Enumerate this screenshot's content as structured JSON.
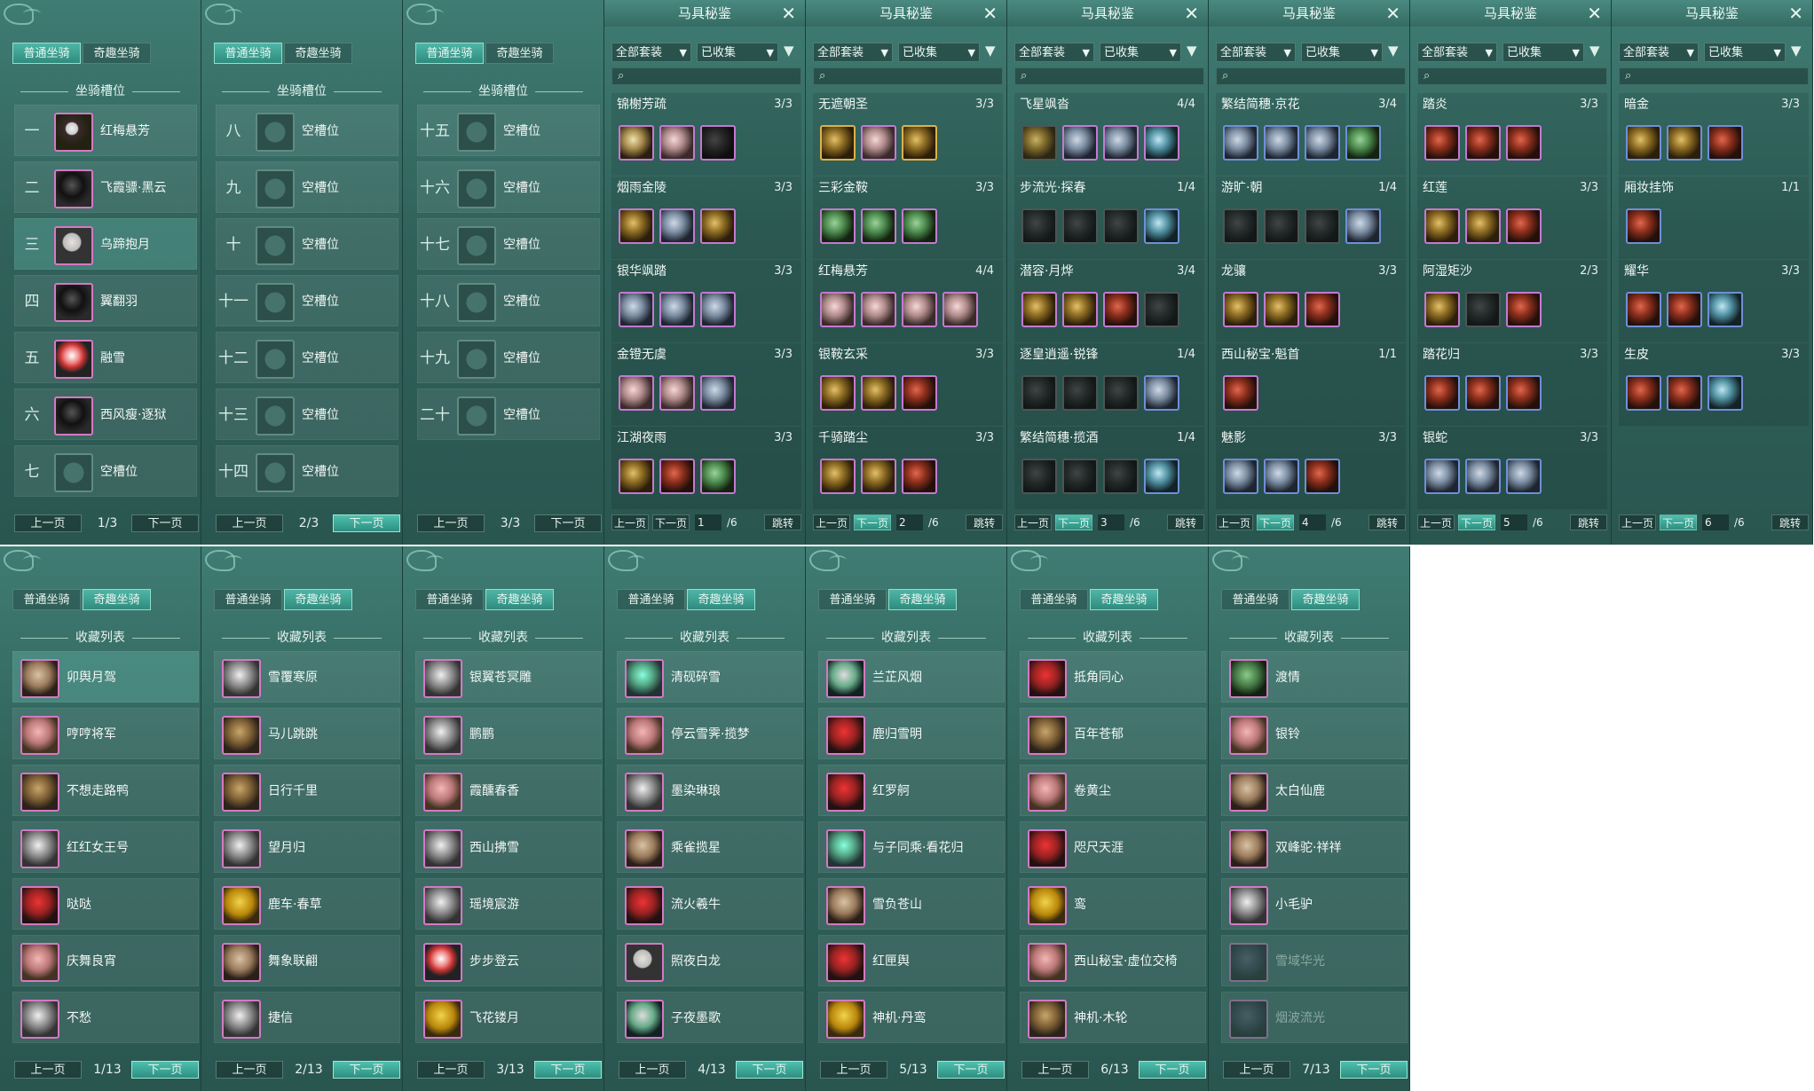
{
  "tabs": {
    "normal": "普通坐骑",
    "fun": "奇趣坐骑"
  },
  "slots_section": "坐骑槽位",
  "collection_section": "收藏列表",
  "pager": {
    "prev": "上一页",
    "next": "下一页"
  },
  "slot_pages": [
    {
      "page": "1/3",
      "slots": [
        {
          "num": "一",
          "name": "红梅悬芳"
        },
        {
          "num": "二",
          "name": "飞霞骠·黑云"
        },
        {
          "num": "三",
          "name": "乌蹄抱月"
        },
        {
          "num": "四",
          "name": "翼翻羽"
        },
        {
          "num": "五",
          "name": "融雪"
        },
        {
          "num": "六",
          "name": "西风瘦·逐狱"
        },
        {
          "num": "七",
          "name": "空槽位"
        }
      ]
    },
    {
      "page": "2/3",
      "slots": [
        {
          "num": "八",
          "name": "空槽位"
        },
        {
          "num": "九",
          "name": "空槽位"
        },
        {
          "num": "十",
          "name": "空槽位"
        },
        {
          "num": "十一",
          "name": "空槽位"
        },
        {
          "num": "十二",
          "name": "空槽位"
        },
        {
          "num": "十三",
          "name": "空槽位"
        },
        {
          "num": "十四",
          "name": "空槽位"
        }
      ]
    },
    {
      "page": "3/3",
      "slots": [
        {
          "num": "十五",
          "name": "空槽位"
        },
        {
          "num": "十六",
          "name": "空槽位"
        },
        {
          "num": "十七",
          "name": "空槽位"
        },
        {
          "num": "十八",
          "name": "空槽位"
        },
        {
          "num": "十九",
          "name": "空槽位"
        },
        {
          "num": "二十",
          "name": "空槽位"
        }
      ]
    }
  ],
  "gear": {
    "title": "马具秘鉴",
    "filter_all": "全部套装",
    "filter_collected": "已收集",
    "jump": "跳转",
    "total": "/6",
    "pages": [
      {
        "page": "1",
        "sets": [
          {
            "name": "锦榭芳疏",
            "count": "3/3"
          },
          {
            "name": "烟雨金陵",
            "count": "3/3"
          },
          {
            "name": "银华飒踏",
            "count": "3/3"
          },
          {
            "name": "金镫无虞",
            "count": "3/3"
          },
          {
            "name": "江湖夜雨",
            "count": "3/3"
          }
        ]
      },
      {
        "page": "2",
        "sets": [
          {
            "name": "无遮朝圣",
            "count": "3/3"
          },
          {
            "name": "三彩金鞍",
            "count": "3/3"
          },
          {
            "name": "红梅悬芳",
            "count": "4/4"
          },
          {
            "name": "银鞍玄采",
            "count": "3/3"
          },
          {
            "name": "千骑踏尘",
            "count": "3/3"
          }
        ]
      },
      {
        "page": "3",
        "sets": [
          {
            "name": "飞星飒沓",
            "count": "4/4"
          },
          {
            "name": "步流光·探春",
            "count": "1/4"
          },
          {
            "name": "潜容·月烨",
            "count": "3/4"
          },
          {
            "name": "逐皇逍遥·锐锋",
            "count": "1/4"
          },
          {
            "name": "繁结简穗·揽酒",
            "count": "1/4"
          }
        ]
      },
      {
        "page": "4",
        "sets": [
          {
            "name": "繁结简穗·京花",
            "count": "3/4"
          },
          {
            "name": "游旷·朝",
            "count": "1/4"
          },
          {
            "name": "龙骧",
            "count": "3/3"
          },
          {
            "name": "西山秘宝·魁首",
            "count": "1/1"
          },
          {
            "name": "魅影",
            "count": "3/3"
          }
        ]
      },
      {
        "page": "5",
        "sets": [
          {
            "name": "踏炎",
            "count": "3/3"
          },
          {
            "name": "红莲",
            "count": "3/3"
          },
          {
            "name": "阿湿矩沙",
            "count": "2/3"
          },
          {
            "name": "踏花归",
            "count": "3/3"
          },
          {
            "name": "银蛇",
            "count": "3/3"
          }
        ]
      },
      {
        "page": "6",
        "sets": [
          {
            "name": "暗金",
            "count": "3/3"
          },
          {
            "name": "厢妆挂饰",
            "count": "1/1"
          },
          {
            "name": "耀华",
            "count": "3/3"
          },
          {
            "name": "生皮",
            "count": "3/3"
          }
        ]
      }
    ]
  },
  "collection_pages": [
    {
      "page": "1/13",
      "items": [
        "卯舆月驾",
        "哼哼将军",
        "不想走路鸭",
        "红红女王号",
        "哒哒",
        "庆舞良宵",
        "不愁"
      ]
    },
    {
      "page": "2/13",
      "items": [
        "雪覆寒原",
        "马儿跳跳",
        "日行千里",
        "望月归",
        "鹿车·春草",
        "舞象联翩",
        "捷信"
      ]
    },
    {
      "page": "3/13",
      "items": [
        "银翼苍冥雕",
        "鹏鹏",
        "霞醺春香",
        "西山拂雪",
        "瑶境宸游",
        "步步登云",
        "飞花镂月"
      ]
    },
    {
      "page": "4/13",
      "items": [
        "清砚碎雪",
        "停云雪霁·揽梦",
        "墨染琳琅",
        "乘雀揽星",
        "流火羲牛",
        "照夜白龙",
        "子夜墨歌"
      ]
    },
    {
      "page": "5/13",
      "items": [
        "兰芷风烟",
        "鹿归雪明",
        "红罗舸",
        "与子同乘·看花归",
        "雪负苍山",
        "红匣舆",
        "神机·丹鸾"
      ]
    },
    {
      "page": "6/13",
      "items": [
        "抵角同心",
        "百年苍郁",
        "卷黄尘",
        "咫尺天涯",
        "鸾",
        "西山秘宝·虚位交椅",
        "神机·木轮"
      ]
    },
    {
      "page": "7/13",
      "items": [
        "渡情",
        "银铃",
        "太白仙鹿",
        "双峰驼·祥祥",
        "小毛驴",
        "雪域华光",
        "烟波流光"
      ]
    }
  ]
}
